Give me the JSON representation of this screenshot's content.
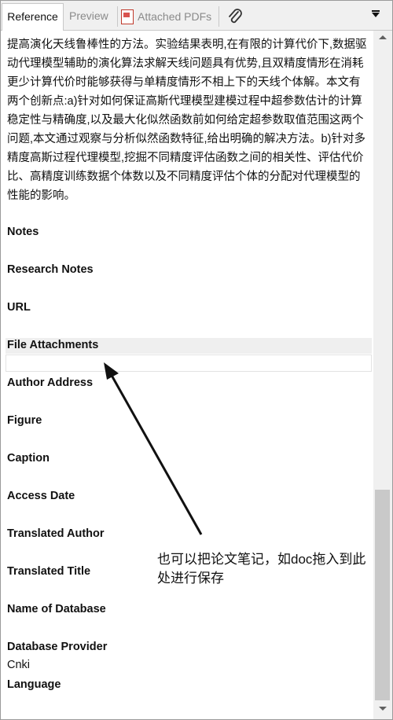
{
  "tabs": {
    "reference": "Reference",
    "preview": "Preview",
    "attached_pdfs": "Attached PDFs"
  },
  "abstract_text": "提高演化天线鲁棒性的方法。实验结果表明,在有限的计算代价下,数据驱动代理模型辅助的演化算法求解天线问题具有优势,且双精度情形在消耗更少计算代价时能够获得与单精度情形不相上下的天线个体解。本文有两个创新点:a)针对如何保证高斯代理模型建模过程中超参数估计的计算稳定性与精确度,以及最大化似然函数前如何给定超参数取值范围这两个问题,本文通过观察与分析似然函数特征,给出明确的解决方法。b)针对多精度高斯过程代理模型,挖掘不同精度评估函数之间的相关性、评估代价比、高精度训练数据个体数以及不同精度评估个体的分配对代理模型的性能的影响。",
  "fields": {
    "notes": "Notes",
    "research_notes": "Research Notes",
    "url": "URL",
    "file_attachments": "File Attachments",
    "author_address": "Author Address",
    "figure": "Figure",
    "caption": "Caption",
    "access_date": "Access Date",
    "translated_author": "Translated Author",
    "translated_title": "Translated Title",
    "name_of_database": "Name of Database",
    "database_provider": "Database Provider",
    "database_provider_value": "Cnki",
    "language": "Language"
  },
  "annotation": "也可以把论文笔记，如doc拖入到此处进行保存",
  "icons": {
    "pdf": "pdf-file-icon",
    "attach": "paperclip-icon",
    "menu": "dropdown-menu-icon"
  }
}
